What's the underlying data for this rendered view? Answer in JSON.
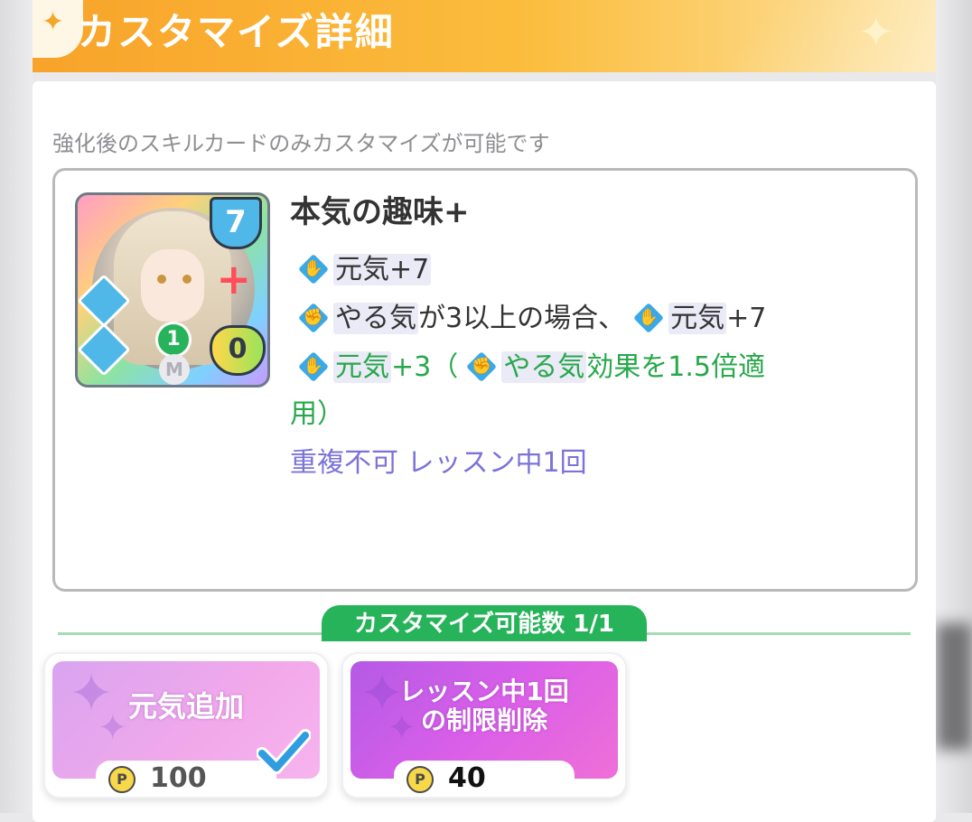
{
  "header": {
    "title": "カスタマイズ詳細",
    "ornament_icon": "✦",
    "sparkle_icon": "✦"
  },
  "notice": "強化後のスキルカードのみカスタマイズが可能です",
  "card": {
    "cost": "7",
    "usage": "1",
    "m_label": "M",
    "heart_value": "0",
    "plus_mark": "+"
  },
  "skill": {
    "name": "本気の趣味+",
    "line1": {
      "text": "元気+7"
    },
    "line2": {
      "part1": "やる気",
      "part2": "が3以上の場合、",
      "part3": "元気",
      "part4": "+7"
    },
    "line3": {
      "part1": "元気",
      "part2": "+3（",
      "part3": "やる気",
      "part4": "効果を1.5倍適"
    },
    "line4": "用）",
    "line5": "重複不可 レッスン中1回"
  },
  "customize": {
    "header": "カスタマイズ可能数 1/1",
    "options": [
      {
        "label": "元気追加",
        "price": "100",
        "selected": true
      },
      {
        "label_line1": "レッスン中1回",
        "label_line2": "の制限削除",
        "price": "40",
        "selected": false
      }
    ],
    "coin_symbol": "P"
  },
  "colors": {
    "header_orange": "#f8a32a",
    "effect_green": "#27a84a",
    "effect_purple": "#7b73d9",
    "section_green": "#27b35a",
    "option1_pink": "#f2a9ea",
    "option2_magenta": "#d95fe8",
    "check_blue": "#2f9de0"
  },
  "icons": [
    "sparkle-icon",
    "vitality-icon",
    "motivation-fist-icon",
    "coin-icon",
    "check-icon"
  ]
}
